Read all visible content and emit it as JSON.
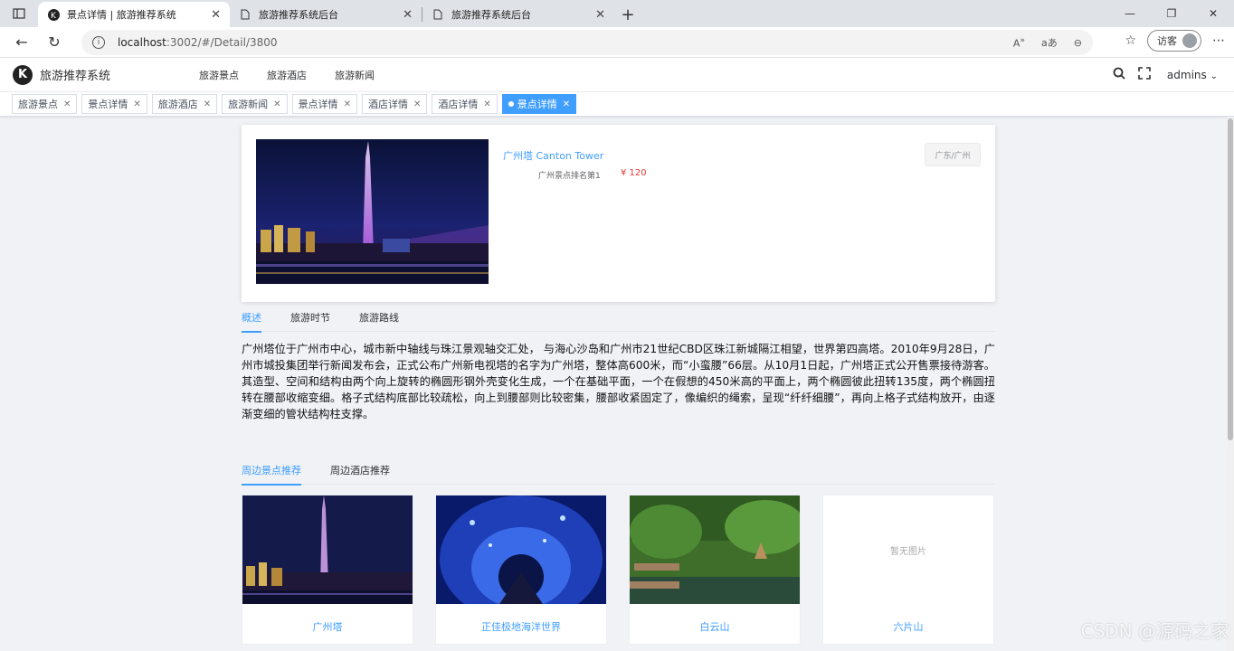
{
  "browser": {
    "tabs": [
      {
        "title": "景点详情 | 旅游推荐系统"
      },
      {
        "title": "旅游推荐系统后台"
      },
      {
        "title": "旅游推荐系统后台"
      }
    ],
    "url_host": "localhost",
    "url_rest": ":3002/#/Detail/3800",
    "guest_label": "访客"
  },
  "app": {
    "name": "旅游推荐系统",
    "menu": [
      "旅游景点",
      "旅游酒店",
      "旅游新闻"
    ],
    "user": "admins"
  },
  "tags": [
    "旅游景点",
    "景点详情",
    "旅游酒店",
    "旅游新闻",
    "景点详情",
    "酒店详情",
    "酒店详情",
    "景点详情"
  ],
  "detail": {
    "name": "广州塔 Canton Tower",
    "rank": "广州景点排名第1",
    "price": "¥ 120",
    "location": "广东/广州",
    "tabs": [
      "概述",
      "旅游时节",
      "旅游路线"
    ],
    "description": "广州塔位于广州市中心，城市新中轴线与珠江景观轴交汇处，  与海心沙岛和广州市21世纪CBD区珠江新城隔江相望，世界第四高塔。2010年9月28日，广州市城投集团举行新闻发布会，正式公布广州新电视塔的名字为广州塔，整体高600米，而“小蛮腰”66层。从10月1日起，广州塔正式公开售票接待游客。其造型、空间和结构由两个向上旋转的椭圆形钢外壳变化生成，一个在基础平面，一个在假想的450米高的平面上，两个椭圆彼此扭转135度，两个椭圆扭转在腰部收缩变细。格子式结构底部比较疏松，向上到腰部则比较密集，腰部收紧固定了，像编织的绳索，呈现“纤纤细腰”，再向上格子式结构放开，由逐渐变细的管状结构柱支撑。"
  },
  "nearby": {
    "tabs": [
      "周边景点推荐",
      "周边酒店推荐"
    ],
    "items": [
      {
        "name": "广州塔"
      },
      {
        "name": "正佳极地海洋世界"
      },
      {
        "name": "白云山"
      },
      {
        "name": "六片山",
        "placeholder": "暂无图片"
      }
    ]
  },
  "watermark": "CSDN @源码之家",
  "colors": {
    "accent": "#409eff",
    "price": "#e4393c"
  }
}
